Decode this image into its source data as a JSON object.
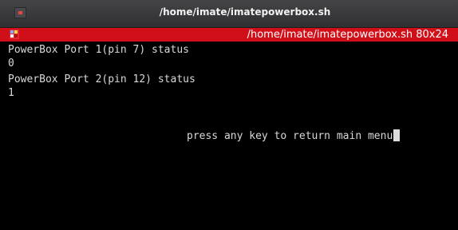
{
  "window": {
    "title": "/home/imate/imatepowerbox.sh"
  },
  "tab": {
    "title": "/home/imate/imatepowerbox.sh 80x24"
  },
  "terminal": {
    "lines": [
      "PowerBox Port 1(pin 7) status",
      "0",
      "PowerBox Port 2(pin 12) status",
      "1"
    ],
    "prompt": "press any key to return main menu"
  },
  "colors": {
    "titlebar": "#3a3a3c",
    "tab_active": "#d10f18",
    "terminal_bg": "#000000",
    "terminal_fg": "#d8d8d8"
  },
  "icons": {
    "window_menu": "window-menu-icon",
    "tab": "terminal-tab-icon",
    "cursor": "block-cursor"
  }
}
